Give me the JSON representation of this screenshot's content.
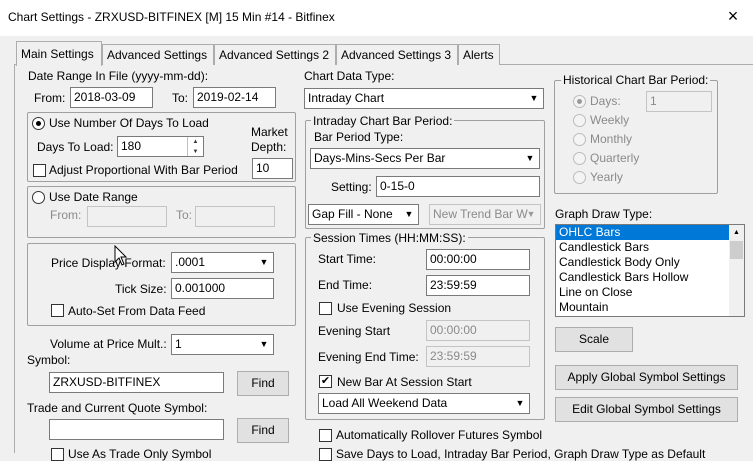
{
  "window": {
    "title": "Chart Settings - ZRXUSD-BITFINEX [M]  15 Min   #14 - Bitfinex",
    "close_icon": "×"
  },
  "tabs": [
    "Main Settings",
    "Advanced Settings",
    "Advanced Settings 2",
    "Advanced Settings 3",
    "Alerts"
  ],
  "date_range": {
    "heading": "Date Range In File (yyyy-mm-dd):",
    "from_label": "From:",
    "from_value": "2018-03-09",
    "to_label": "To:",
    "to_value": "2019-02-14"
  },
  "days_group": {
    "use_days_label": "Use Number Of Days To Load",
    "days_to_load_label": "Days To Load:",
    "days_to_load_value": "180",
    "market_label": "Market",
    "depth_label": "Depth:",
    "market_depth_value": "10",
    "adjust_label": "Adjust Proportional With Bar Period"
  },
  "date_range_group": {
    "use_date_range_label": "Use Date Range",
    "from_label": "From:",
    "to_label": "To:"
  },
  "price_group": {
    "price_format_label": "Price Display Format:",
    "price_format_value": ".0001",
    "tick_size_label": "Tick Size:",
    "tick_size_value": "0.001000",
    "auto_set_label": "Auto-Set From Data Feed"
  },
  "volume": {
    "label": "Volume at Price Mult.:",
    "value": "1"
  },
  "symbol": {
    "label": "Symbol:",
    "value": "ZRXUSD-BITFINEX",
    "find_label": "Find"
  },
  "trade_symbol": {
    "label": "Trade and Current Quote Symbol:",
    "value": "",
    "find_label": "Find",
    "bottom_label": "Use As Trade Only Symbol"
  },
  "chart_data_type": {
    "label": "Chart Data Type:",
    "value": "Intraday Chart"
  },
  "intraday": {
    "group_title": "Intraday Chart Bar Period:",
    "bar_period_type_label": "Bar Period Type:",
    "bar_period_type_value": "Days-Mins-Secs Per Bar",
    "setting_label": "Setting:",
    "setting_value": "0-15-0",
    "gap_fill_value": "Gap Fill - None",
    "new_trend_value": "New Trend Bar W"
  },
  "session": {
    "group_title": "Session Times (HH:MM:SS):",
    "start_label": "Start Time:",
    "start_value": "00:00:00",
    "end_label": "End Time:",
    "end_value": "23:59:59",
    "use_evening_label": "Use Evening Session",
    "evening_start_label": "Evening Start",
    "evening_start_value": "00:00:00",
    "evening_end_label": "Evening End Time:",
    "evening_end_value": "23:59:59",
    "new_bar_label": "New Bar At Session Start",
    "weekend_value": "Load All Weekend Data"
  },
  "rollover": {
    "label": "Automatically Rollover Futures Symbol",
    "bottom_label": "Save Days to Load, Intraday Bar Period, Graph Draw Type as Default"
  },
  "historical": {
    "group_title": "Historical Chart Bar Period:",
    "days_label": "Days:",
    "days_value": "1",
    "options": [
      "Weekly",
      "Monthly",
      "Quarterly",
      "Yearly"
    ]
  },
  "graph_draw": {
    "label": "Graph Draw Type:",
    "items": [
      "OHLC Bars",
      "Candlestick Bars",
      "Candlestick Body Only",
      "Candlestick Bars Hollow",
      "Line on Close",
      "Mountain"
    ],
    "selected_index": 0
  },
  "buttons": {
    "scale": "Scale",
    "apply_global": "Apply Global Symbol Settings",
    "edit_global": "Edit Global Symbol Settings"
  },
  "colors": {
    "selection": "#0078d7",
    "window_bg": "#f0f0f0",
    "group_border": "#a0a0a0"
  }
}
